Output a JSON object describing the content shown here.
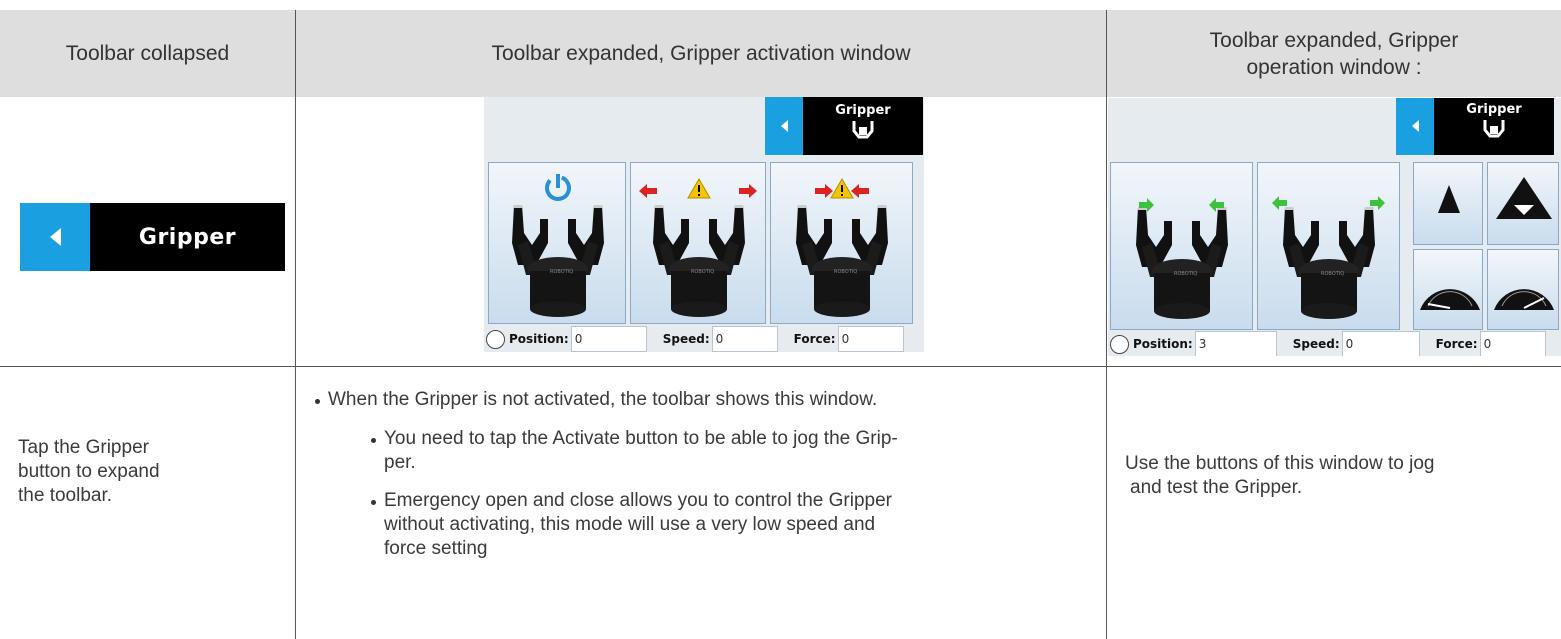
{
  "headers": {
    "col1": "Toolbar collapsed",
    "col2": "Toolbar expanded, Gripper activation window",
    "col3_line1": "Toolbar expanded, Gripper",
    "col3_line2": "operation window :"
  },
  "toolbar_label": "Gripper",
  "activation_window": {
    "toolbar_label": "Gripper",
    "position_label": "Position:",
    "position_value": "0",
    "speed_label": "Speed:",
    "speed_value": "0",
    "force_label": "Force:",
    "force_value": "0",
    "buttons": [
      "activate",
      "emergency-open",
      "emergency-close"
    ]
  },
  "operation_window": {
    "toolbar_label": "Gripper",
    "position_label": "Position:",
    "position_value": "3",
    "speed_label": "Speed:",
    "speed_value": "0",
    "force_label": "Force:",
    "force_value": "0",
    "buttons": [
      "open",
      "close",
      "position-low",
      "position-high",
      "speed-low",
      "speed-high"
    ]
  },
  "col1_text": [
    "Tap the Gripper",
    "button to expand",
    "the toolbar."
  ],
  "col2_bullets": {
    "main": "When the Gripper is not activated, the toolbar shows this window.",
    "sub1_line1": "You need to tap the Activate button to be able to jog the Grip-",
    "sub1_line2": "per.",
    "sub2_line1": "Emergency open and close allows you to control the Gripper",
    "sub2_line2": "without activating, this mode will use a very low speed and",
    "sub2_line3": "force setting"
  },
  "col3_text": [
    "Use the buttons of this window to jog",
    "and test the Gripper."
  ],
  "colors": {
    "accent": "#1a9fe0",
    "header_bg": "#dedede",
    "arrow_green": "#3cc23c",
    "arrow_red": "#dd2222",
    "warning": "#f5c400"
  }
}
